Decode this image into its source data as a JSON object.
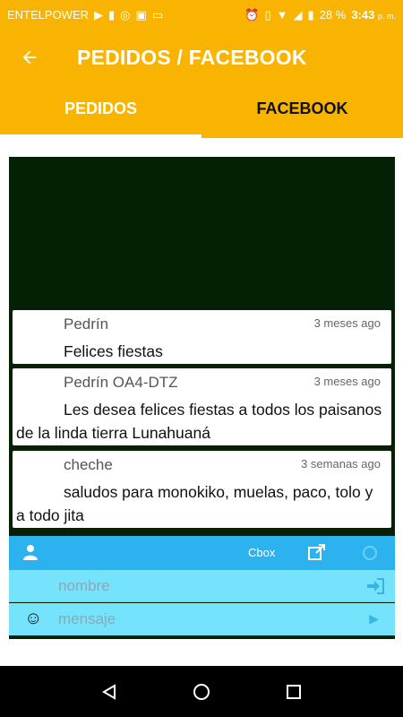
{
  "status": {
    "carrier": "ENTELPOWER",
    "battery": "28 %",
    "time": "3:43",
    "ampm": "p. m.",
    "icons_left": [
      "play-icon",
      "sim-icon",
      "chrome-icon",
      "image-icon",
      "laptop-icon"
    ],
    "icons_right": [
      "alarm-icon",
      "vibrate-icon",
      "wifi-icon",
      "signal-icon",
      "battery-icon"
    ]
  },
  "app_bar": {
    "title": "PEDIDOS / FACEBOOK"
  },
  "tabs": [
    {
      "label": "PEDIDOS",
      "active": true
    },
    {
      "label": "FACEBOOK",
      "active": false
    }
  ],
  "messages": [
    {
      "name": "Pedrín",
      "time": "3 meses ago",
      "text": "Felices fiestas"
    },
    {
      "name": "Pedrín OA4-DTZ",
      "time": "3 meses ago",
      "text": "Les desea felices fiestas a todos los paisanos de la linda tierra Lunahuaná"
    },
    {
      "name": "cheche",
      "time": "3 semanas ago",
      "text": "saludos para monokiko, muelas, paco, tolo y a todo jita"
    }
  ],
  "cbox": {
    "label": "Cbox",
    "name_placeholder": "nombre",
    "message_placeholder": "mensaje"
  },
  "colors": {
    "accent": "#f8b400",
    "widget_bg": "#062006",
    "cbox_bar": "#2db2f0",
    "cbox_fields": "#74e3fb"
  }
}
